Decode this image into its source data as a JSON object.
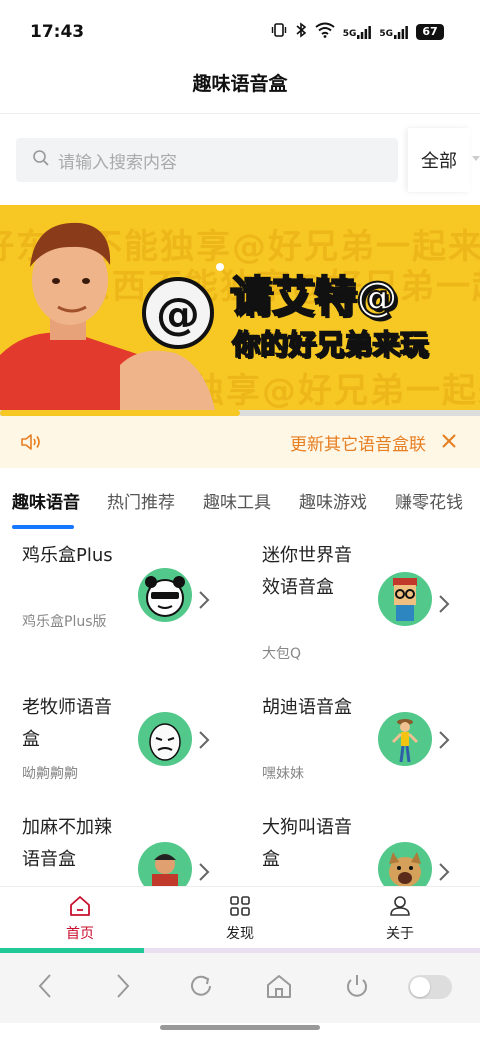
{
  "status_bar": {
    "time": "17:43",
    "signal_1": "5G",
    "signal_2": "5G",
    "battery": "67"
  },
  "header": {
    "title": "趣味语音盒"
  },
  "search": {
    "placeholder": "请输入搜索内容",
    "filter_label": "全部"
  },
  "banner": {
    "title": "请艾特@",
    "subtitle": "你的好兄弟来玩",
    "bg_text": "好东西不能独享@好兄弟一起来",
    "slide_count": 2,
    "active_slide": 1,
    "dot_color_active": "#f7c823",
    "dot_color_inactive": "#dddddd"
  },
  "notice": {
    "text": "更新其它语音盒联"
  },
  "tabs": [
    {
      "label": "趣味语音"
    },
    {
      "label": "热门推荐"
    },
    {
      "label": "趣味工具"
    },
    {
      "label": "趣味游戏"
    },
    {
      "label": "赚零花钱"
    }
  ],
  "items": [
    {
      "name": "鸡乐盒Plus",
      "subtitle": "鸡乐盒Plus版",
      "avatar_icon": "panda-meme-icon"
    },
    {
      "name": "迷你世界音效语音盒",
      "subtitle": "大包Q",
      "avatar_icon": "mini-world-character-icon"
    },
    {
      "name": "老牧师语音盒",
      "subtitle": "呦齁齁齁",
      "avatar_icon": "meme-face-icon"
    },
    {
      "name": "胡迪语音盒",
      "subtitle": "嘿妹妹",
      "avatar_icon": "woody-icon"
    },
    {
      "name": "加麻不加辣语音盒",
      "subtitle": "",
      "avatar_icon": "person-avatar-icon"
    },
    {
      "name": "大狗叫语音盒",
      "subtitle": "",
      "avatar_icon": "dog-icon"
    }
  ],
  "bottom_nav": [
    {
      "label": "首页",
      "icon": "home-icon",
      "active": true
    },
    {
      "label": "发现",
      "icon": "grid-icon",
      "active": false
    },
    {
      "label": "关于",
      "icon": "user-icon",
      "active": false
    }
  ],
  "nav_progress": 0.3,
  "colors": {
    "accent_red": "#c8102e",
    "tab_indicator": "#1677ff",
    "banner_bg": "#f7c823",
    "notice_text": "#e67e22",
    "avatar_bg": "#52c98a",
    "progress_fill": "#20c997"
  }
}
